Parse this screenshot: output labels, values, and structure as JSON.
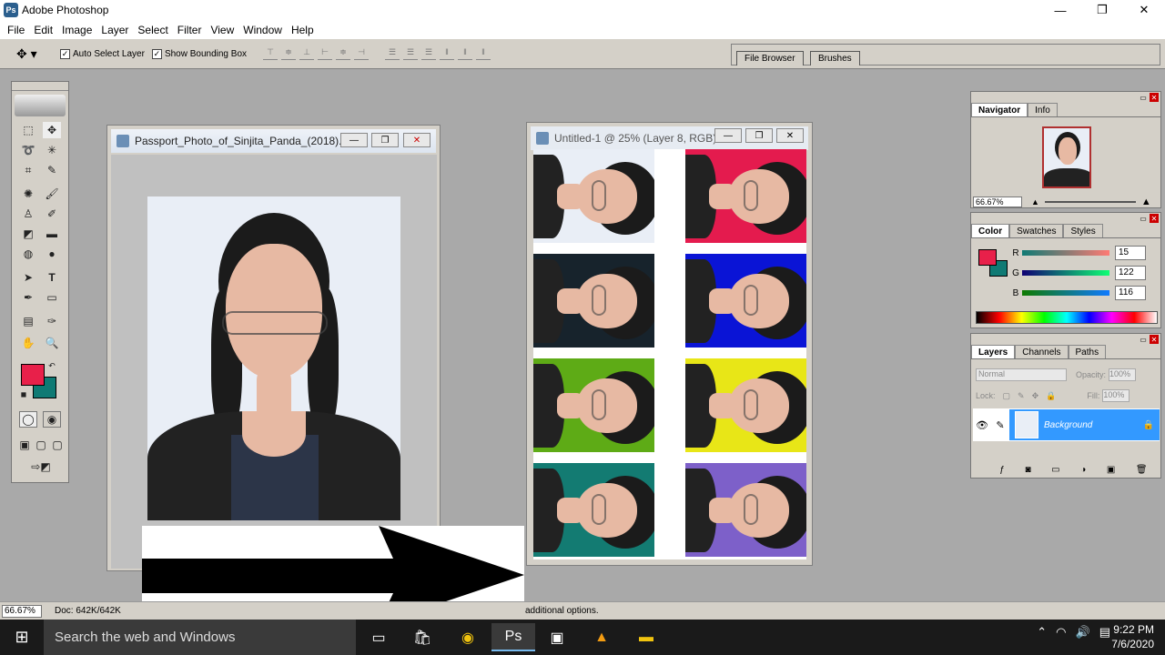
{
  "window": {
    "title": "Adobe Photoshop",
    "controls": {
      "minimize": "—",
      "maximize": "❐",
      "close": "✕"
    }
  },
  "menu": [
    "File",
    "Edit",
    "Image",
    "Layer",
    "Select",
    "Filter",
    "View",
    "Window",
    "Help"
  ],
  "options_bar": {
    "auto_select_layer": "Auto Select Layer",
    "auto_select_checked": true,
    "show_bounding_box": "Show Bounding Box",
    "show_bounding_checked": true
  },
  "palette_well": {
    "tabs": [
      "File Browser",
      "Brushes"
    ]
  },
  "toolbox": {
    "foreground_color": "#e8204a",
    "background_color": "#0f7a74"
  },
  "doc_window_1": {
    "title": "Passport_Photo_of_Sinjita_Panda_(2018)....",
    "photo_bg": "#e9eef6"
  },
  "doc_window_2": {
    "title": "Untitled-1 @ 25% (Layer 8, RGB)",
    "tile_colors": [
      "#e9eef6",
      "#e41b4e",
      "#17232c",
      "#0a14d6",
      "#5eab16",
      "#e8e617",
      "#137b72",
      "#7d60c9"
    ]
  },
  "navigator": {
    "tabs": [
      "Navigator",
      "Info"
    ],
    "zoom": "66.67%"
  },
  "color_panel": {
    "tabs": [
      "Color",
      "Swatches",
      "Styles"
    ],
    "r_label": "R",
    "g_label": "G",
    "b_label": "B",
    "r": "15",
    "g": "122",
    "b": "116",
    "fg": "#e8204a",
    "bg": "#0f7a74"
  },
  "layers_panel": {
    "tabs": [
      "Layers",
      "Channels",
      "Paths"
    ],
    "blend_mode": "Normal",
    "opacity_label": "Opacity:",
    "opacity": "100%",
    "lock_label": "Lock:",
    "fill_label": "Fill:",
    "fill": "100%",
    "layer_name": "Background"
  },
  "status_bar": {
    "zoom": "66.67%",
    "doc": "Doc: 642K/642K",
    "hint": "additional options."
  },
  "taskbar": {
    "search_placeholder": "Search the web and Windows",
    "time": "9:22 PM",
    "date": "7/6/2020"
  }
}
